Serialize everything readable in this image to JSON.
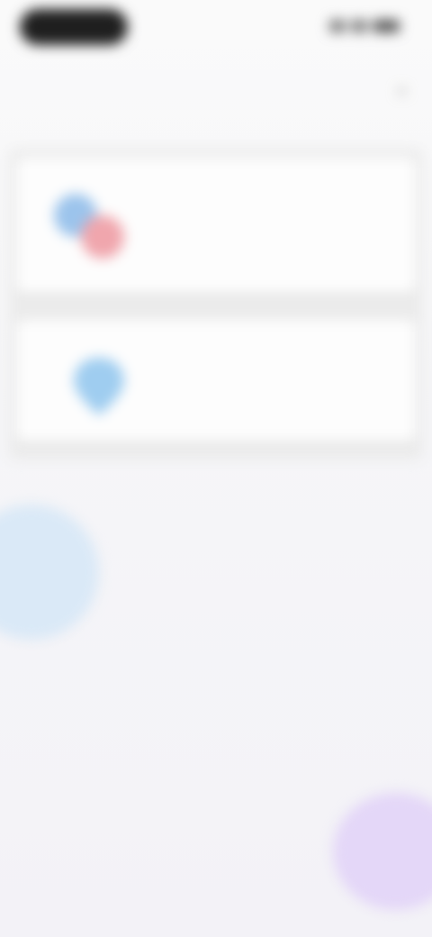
{
  "header": {
    "title": ""
  },
  "cards": [
    {
      "title": "",
      "description": "",
      "icon": "two-profiles-icon"
    },
    {
      "title": "",
      "description": "",
      "icon": "location-pin-icon"
    }
  ],
  "colors": {
    "profile_blue": "#9cc4ec",
    "profile_red": "#f0a6ad",
    "pin_blue": "#9fcdf0",
    "accent_purple": "#d8c8f6"
  }
}
